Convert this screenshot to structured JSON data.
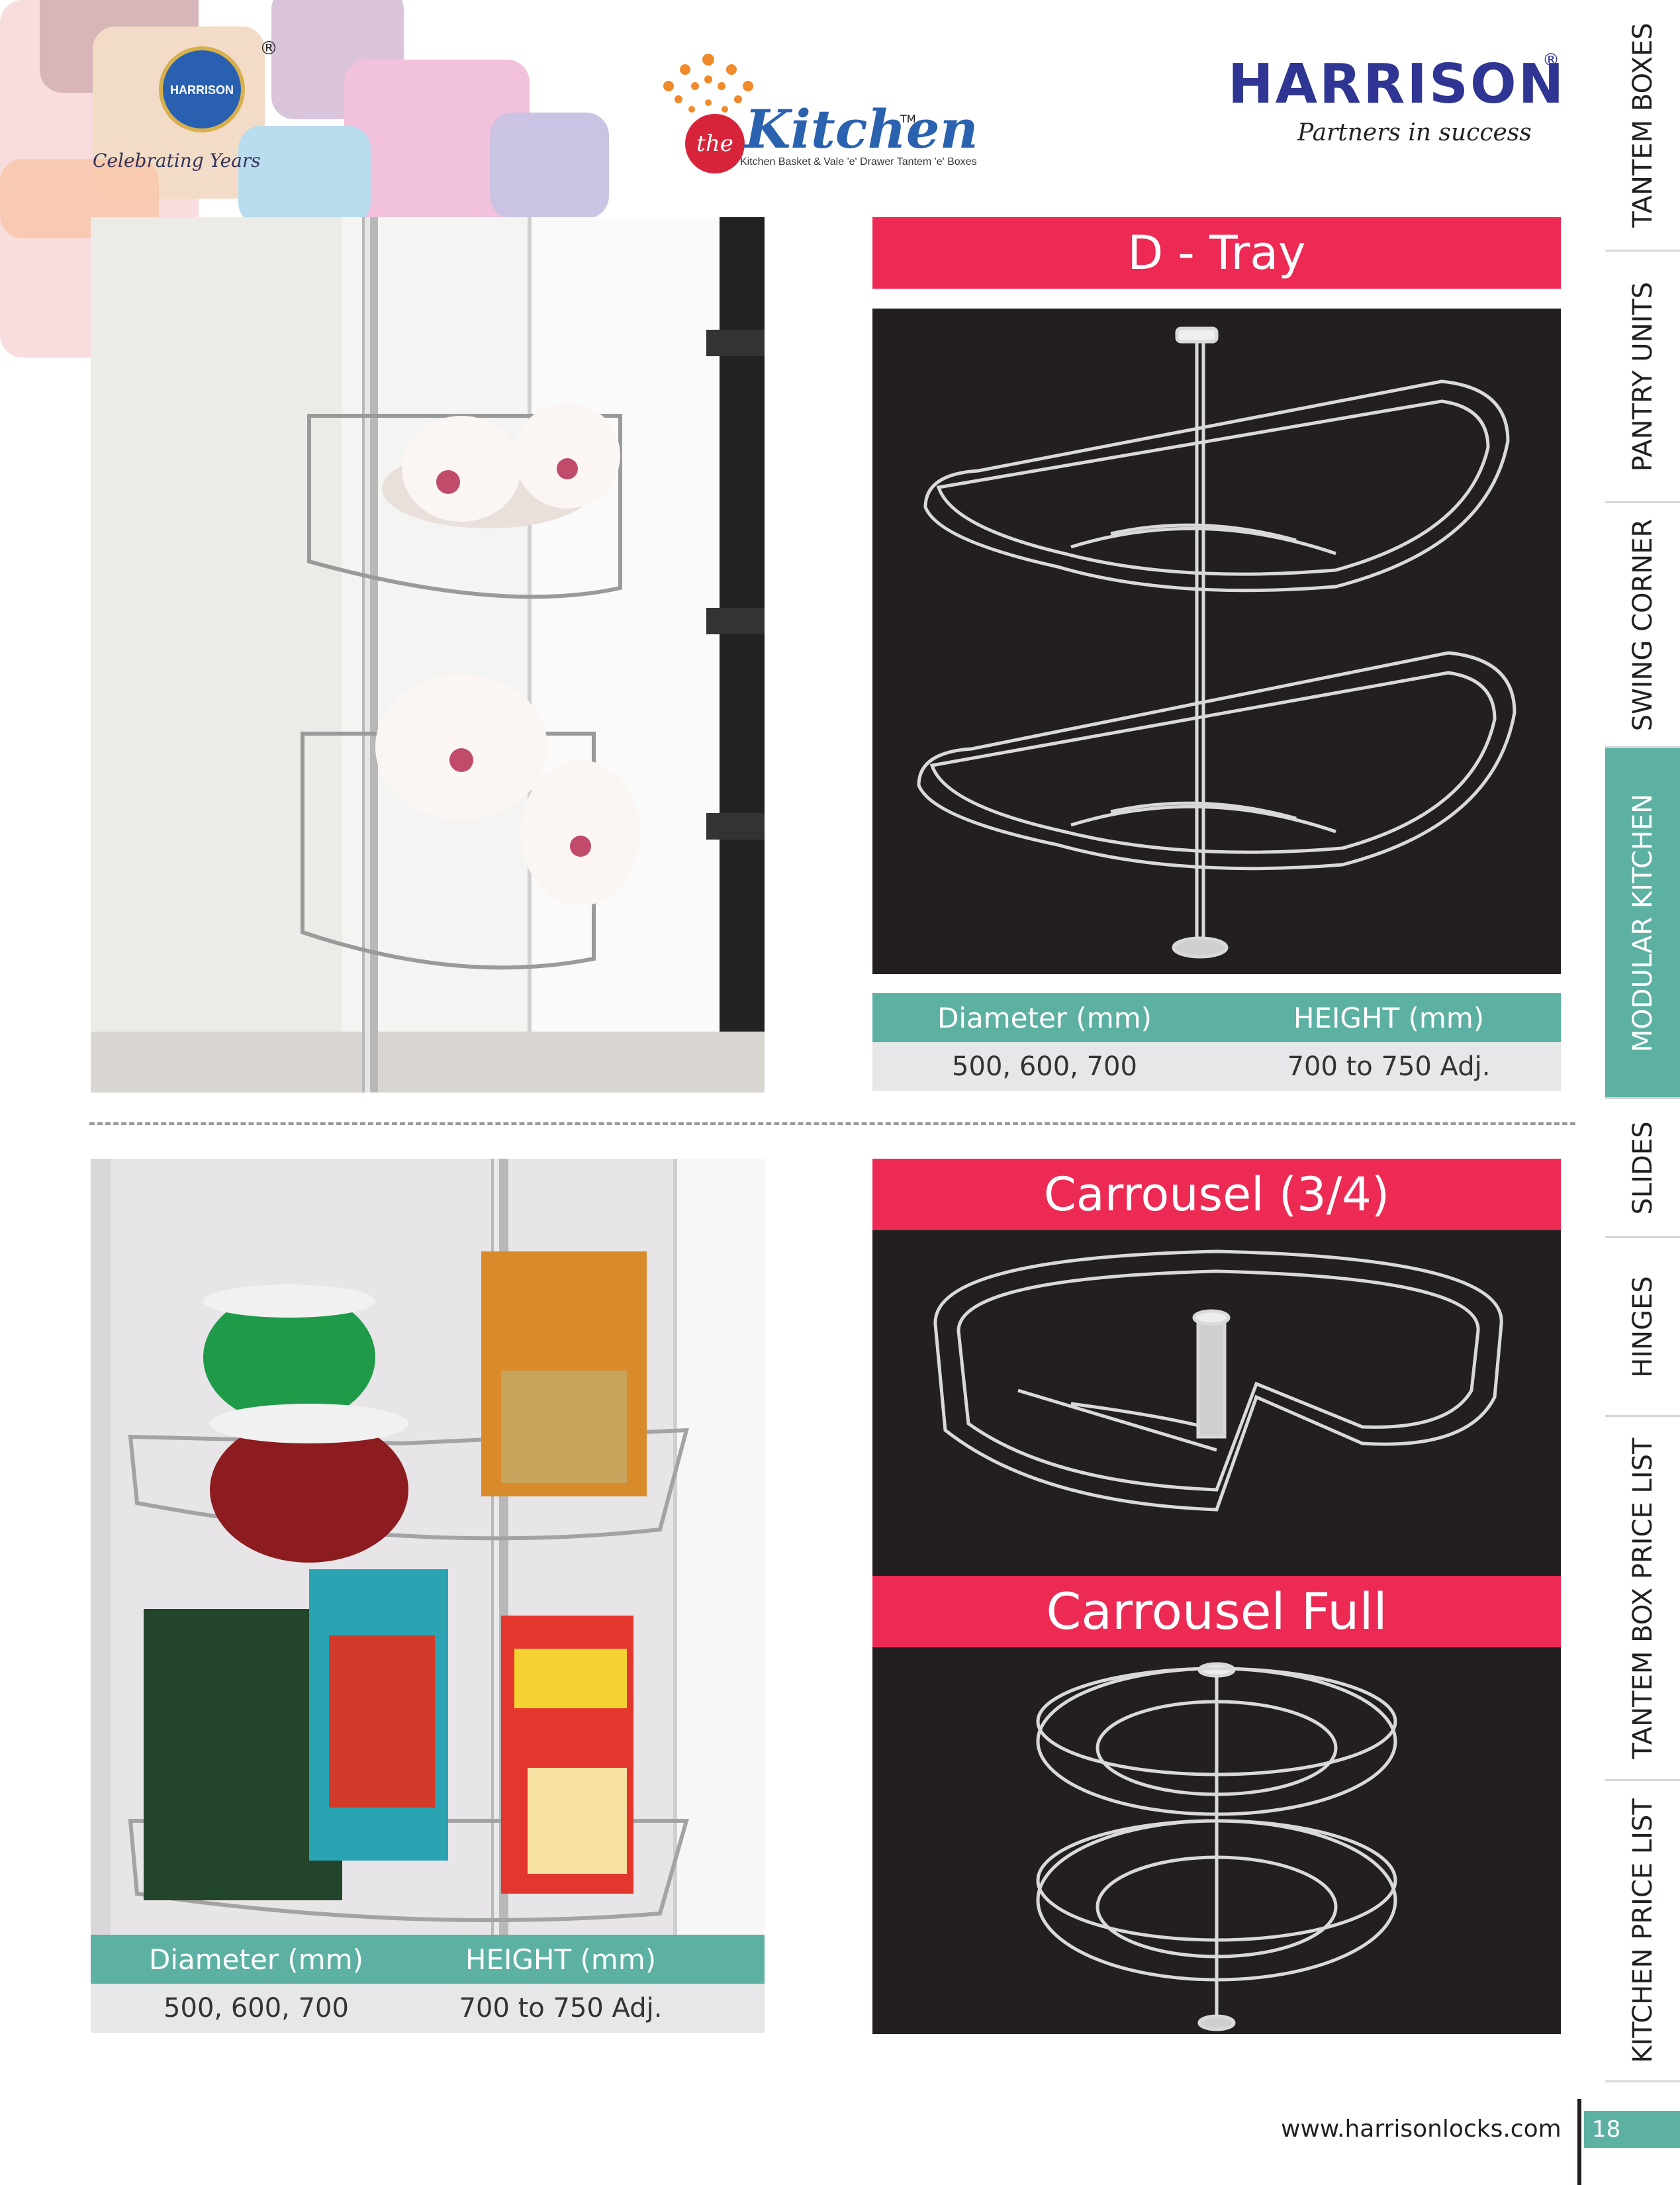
{
  "header": {
    "crest_text": "HARRISON",
    "crest_registered": "®",
    "celebrating_text": "Celebrating Years",
    "kitchen_brand_the": "the",
    "kitchen_brand_name": "Kitchen",
    "kitchen_brand_tm": "TM",
    "kitchen_tagline": "Kitchen Basket & Vale 'e' Drawer Tantem 'e' Boxes",
    "company_name": "HARRISON",
    "company_registered": "®",
    "company_tagline": "Partners in success"
  },
  "products": {
    "d_tray": {
      "title": "D - Tray",
      "spec_headers": [
        "Diameter (mm)",
        "HEIGHT (mm)"
      ],
      "spec_values": [
        "500, 600, 700",
        "700 to 750 Adj."
      ]
    },
    "carrousel_three_quarter": {
      "title": "Carrousel (3/4)",
      "spec_headers": [
        "Diameter (mm)",
        "HEIGHT (mm)"
      ],
      "spec_values": [
        "500, 600, 700",
        "700 to 750 Adj."
      ]
    },
    "carrousel_full": {
      "title": "Carrousel Full"
    }
  },
  "side_tabs": [
    {
      "label": "TANTEM BOXES",
      "active": false
    },
    {
      "label": "PANTRY UNITS",
      "active": false
    },
    {
      "label": "SWING CORNER",
      "active": false
    },
    {
      "label": "MODULAR KITCHEN",
      "active": true
    },
    {
      "label": "SLIDES",
      "active": false
    },
    {
      "label": "HINGES",
      "active": false
    },
    {
      "label": "TANTEM BOX PRICE LIST",
      "active": false
    },
    {
      "label": "KITCHEN PRICE LIST",
      "active": false
    }
  ],
  "footer": {
    "website": "www.harrisonlocks.com",
    "page_number": "18"
  },
  "colors": {
    "title_bar": "#ec2a54",
    "spec_header": "#5cb1a3",
    "spec_row": "#e6e7e8",
    "dark_panel": "#231f20",
    "brand_blue": "#2e3592"
  }
}
